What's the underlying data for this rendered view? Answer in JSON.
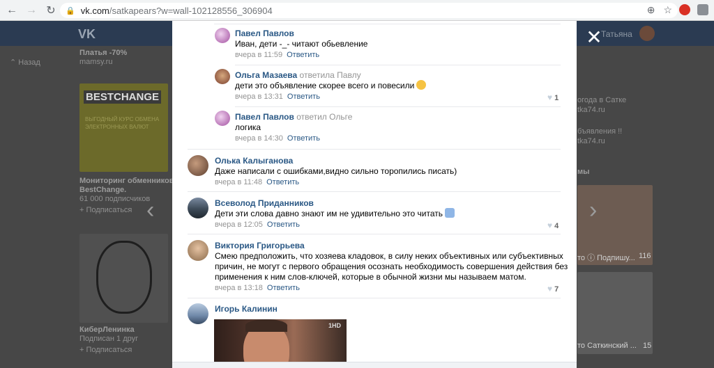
{
  "browser": {
    "url_host": "vk.com",
    "url_path": "/satkapears?w=wall-102128556_306904"
  },
  "vk": {
    "logo": "VK",
    "user_name": "Татьяна"
  },
  "background": {
    "ad_title": "Платья -70%",
    "ad_site": "mamsy.ru",
    "back_link": "Назад",
    "bestchange_logo": "BESTCHANGE",
    "bestchange_tag": "ВЫГОДНЫЙ КУРС ОБМЕНА ЭЛЕКТРОННЫХ ВАЛЮТ",
    "group1_name1": "Мониторинг обменников",
    "group1_name2": "BestChange.",
    "group1_members": "61 000 подписчиков",
    "group1_subscribe": "+ Подписаться",
    "group2_name": "КиберЛенинка",
    "group2_sub": "Подписан 1 друг",
    "group2_subscribe": "+ Подписаться",
    "right1": "огода в Сатке",
    "right2": "tka74.ru",
    "right3": "бъявления !!",
    "right4": "tka74.ru",
    "right5": "мы",
    "right6": "то ⓘ Подпишу...",
    "right6_count": "116",
    "right7": "то Саткинский ...",
    "right7_count": "15"
  },
  "comments": [
    {
      "author": "Павел Павлов",
      "reply_to": "",
      "text": "Иван, дети -_- читают обьевление",
      "time": "вчера в 11:59",
      "reply_label": "Ответить",
      "likes": ""
    },
    {
      "author": "Ольга Мазаева",
      "reply_to": "ответила Павлу",
      "text": "дети это объявление скорее всего и повесили",
      "time": "вчера в 13:31",
      "reply_label": "Ответить",
      "likes": "1"
    },
    {
      "author": "Павел Павлов",
      "reply_to": "ответил Ольге",
      "text": "логика",
      "time": "вчера в 14:30",
      "reply_label": "Ответить",
      "likes": ""
    },
    {
      "author": "Олька Калыганова",
      "reply_to": "",
      "text": "Даже написали с ошибками,видно сильно торопились писать)",
      "time": "вчера в 11:48",
      "reply_label": "Ответить",
      "likes": ""
    },
    {
      "author": "Всеволод Приданников",
      "reply_to": "",
      "text": "Дети эти слова давно знают им не удивительно это читать",
      "time": "вчера в 12:05",
      "reply_label": "Ответить",
      "likes": "4"
    },
    {
      "author": "Виктория Григорьева",
      "reply_to": "",
      "lines": [
        "Смею предположить, что хозяева кладовок, в силу неких объективных или субъективных",
        "причин, не могут с первого обращения осознать необходимость совершения действия без",
        "применения к ним слов-ключей, которые в обычной жизни мы называем матом."
      ],
      "time": "вчера в 13:18",
      "reply_label": "Ответить",
      "likes": "7"
    },
    {
      "author": "Игорь Калинин",
      "reply_to": "",
      "time": "",
      "reply_label": "",
      "likes": "",
      "gif_logo": "1HD"
    }
  ],
  "colors": {
    "link": "#2a5885",
    "meta": "#939393",
    "vk_header": "#2b3b52"
  }
}
